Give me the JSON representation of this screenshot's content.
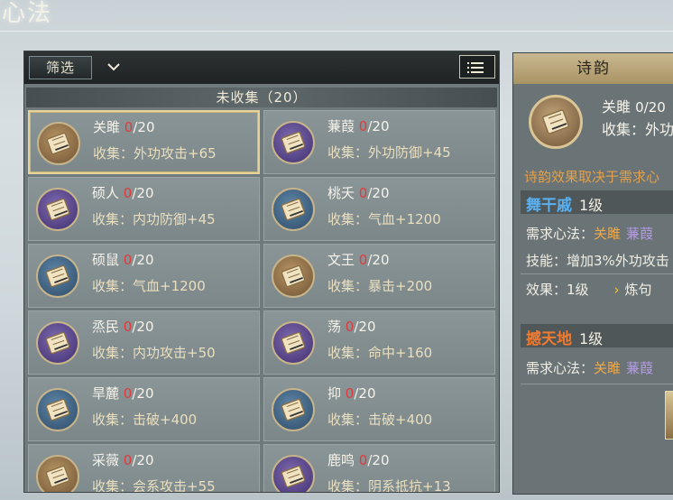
{
  "page": {
    "title": "心法"
  },
  "toolbar": {
    "filter_label": "筛选"
  },
  "section": {
    "title": "未收集（20）"
  },
  "cards": [
    {
      "name": "关雎",
      "current": "0",
      "max": "/20",
      "stat": "收集：外功攻击+65",
      "icon_color": "brown"
    },
    {
      "name": "蒹葭",
      "current": "0",
      "max": "/20",
      "stat": "收集：外功防御+45",
      "icon_color": "purple"
    },
    {
      "name": "硕人",
      "current": "0",
      "max": "/20",
      "stat": "收集：内功防御+45",
      "icon_color": "purple"
    },
    {
      "name": "桃夭",
      "current": "0",
      "max": "/20",
      "stat": "收集：气血+1200",
      "icon_color": "blue"
    },
    {
      "name": "硕鼠",
      "current": "0",
      "max": "/20",
      "stat": "收集：气血+1200",
      "icon_color": "blue"
    },
    {
      "name": "文王",
      "current": "0",
      "max": "/20",
      "stat": "收集：暴击+200",
      "icon_color": "brown"
    },
    {
      "name": "烝民",
      "current": "0",
      "max": "/20",
      "stat": "收集：内功攻击+50",
      "icon_color": "purple"
    },
    {
      "name": "荡",
      "current": "0",
      "max": "/20",
      "stat": "收集：命中+160",
      "icon_color": "purple"
    },
    {
      "name": "旱麓",
      "current": "0",
      "max": "/20",
      "stat": "收集：击破+400",
      "icon_color": "blue"
    },
    {
      "name": "抑",
      "current": "0",
      "max": "/20",
      "stat": "收集：击破+400",
      "icon_color": "blue"
    },
    {
      "name": "采薇",
      "current": "0",
      "max": "/20",
      "stat": "收集：会系攻击+55",
      "icon_color": "brown"
    },
    {
      "name": "鹿鸣",
      "current": "0",
      "max": "/20",
      "stat": "收集：阴系抵抗+13",
      "icon_color": "purple"
    }
  ],
  "detail": {
    "header": "诗韵",
    "name": "关雎",
    "progress": "0/20",
    "collect": "收集：外功攻",
    "note": "诗韵效果取决于需求心",
    "poem1": {
      "title": "舞干戚",
      "level": "1级",
      "title_color": "#5ab0f0",
      "req_label": "需求心法：",
      "req1": "关雎",
      "req2": "蒹葭",
      "skill": "技能：增加3%外功攻击",
      "effect_label": "效果：1级",
      "effect_next": "炼句"
    },
    "poem2": {
      "title": "撼天地",
      "level": "1级",
      "title_color": "#f07a30",
      "req_label": "需求心法：",
      "req1": "关雎",
      "req2": "蒹葭"
    }
  },
  "colors": {
    "red_count": "#e03b3b",
    "orange": "#f0a848",
    "purple": "#b69ae6",
    "gold_border": "#e6d39a"
  }
}
